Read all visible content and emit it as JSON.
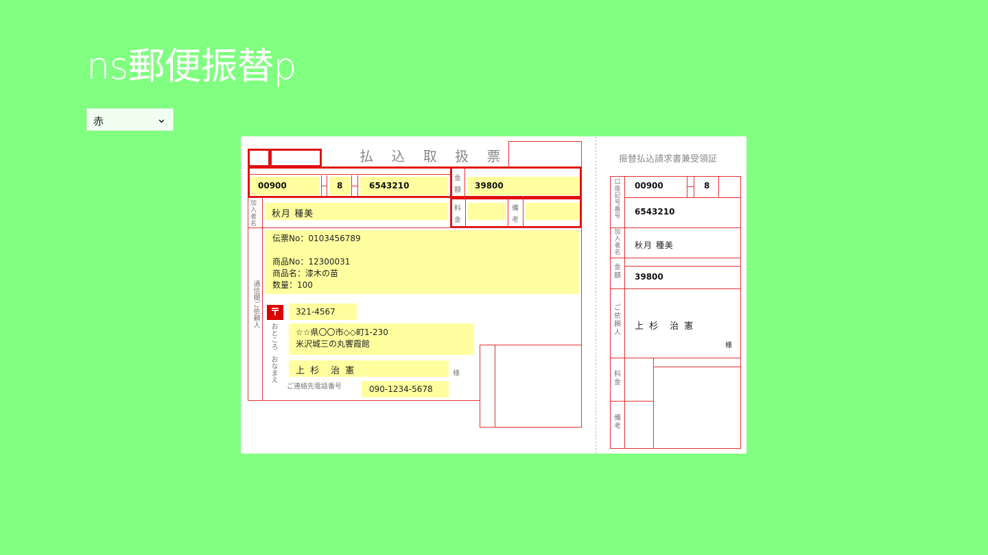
{
  "app": {
    "title": "ns郵便振替p"
  },
  "color_select": {
    "value": "赤",
    "chevron": "chevron-down-icon"
  },
  "form": {
    "title": "払 込 取 扱 票",
    "labels": {
      "amount": "金\n額",
      "subscriber": "加\n入\n者\n名",
      "fee": "料\n金",
      "remarks": "備\n考",
      "message": "通信欄ご依頼人",
      "address": "おところ",
      "name": "おなまえ",
      "phone_label": "ご連絡先電話番号",
      "sama": "様"
    },
    "account_prefix": "00900",
    "account_check": "8",
    "account_number": "6543210",
    "amount": "39800",
    "subscriber_name": "秋月 種美",
    "message": "伝票No：0103456789\n\n商品No：12300031\n商品名：漆木の苗\n数量：100",
    "postal_code": "321-4567",
    "address": "☆☆県〇〇市◇◇町1-230\n米沢城三の丸饗霞館",
    "requester_name": "上 杉　治 憲",
    "phone": "090-1234-5678"
  },
  "receipt": {
    "title": "振替払込請求書兼受領証",
    "labels": {
      "account": "口座記号番号",
      "subscriber": "加入者名",
      "amount": "金額",
      "requester": "ご依頼人",
      "fee": "料金",
      "remarks": "備考",
      "sama": "様"
    },
    "account_prefix": "00900",
    "account_check": "8",
    "account_number": "6543210",
    "subscriber_name": "秋月 種美",
    "amount": "39800",
    "requester_name": "上 杉　治 憲"
  },
  "colors": {
    "background": "#80ff80",
    "line": "#e03030",
    "field": "#ffff9f"
  }
}
